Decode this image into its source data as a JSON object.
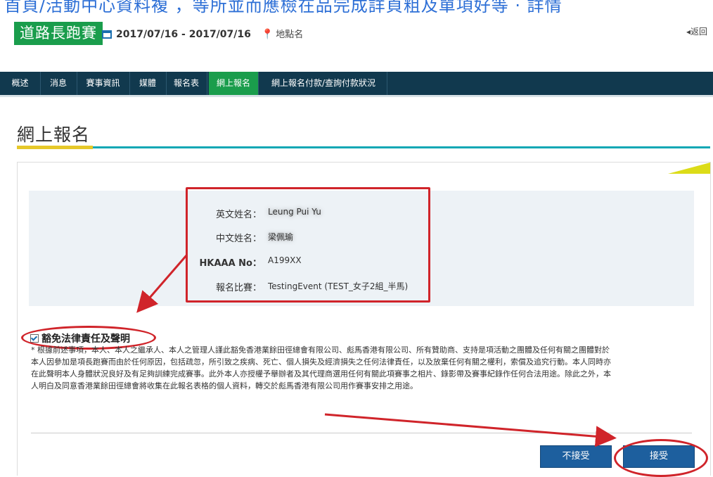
{
  "top_strip": {
    "text": "首頁/活動中心資料複 ，等所並而應檢在品完成詳頁粗及單項好等 · 詳情"
  },
  "header": {
    "title": "道路長跑賽",
    "date_range": "2017/07/16 - 2017/07/16",
    "location": "地點名",
    "back_label": "◂返回"
  },
  "nav": {
    "items": [
      {
        "label": "概述"
      },
      {
        "label": "消息"
      },
      {
        "label": "賽事資訊"
      },
      {
        "label": "媒體"
      },
      {
        "label": "報名表"
      },
      {
        "label": "網上報名",
        "active": true
      },
      {
        "label": "網上報名付款/查詢付款狀況"
      }
    ]
  },
  "page": {
    "title": "網上報名"
  },
  "info": {
    "english_name_label": "英文姓名：",
    "english_name_value": "Leung Pui Yu",
    "chinese_name_label": "中文姓名：",
    "chinese_name_value": "梁佩瑜",
    "hkaaa_label": "HKAAA No：",
    "hkaaa_value": "A199XX",
    "event_label": "報名比賽：",
    "event_value": "TestingEvent (TEST_女子2組_半馬)"
  },
  "disclaimer": {
    "checkbox_label": "豁免法律責任及聲明",
    "text": "* 根據前述事項，本人、本人之繼承人、本人之管理人謹此豁免香港業餘田徑總會有限公司、彪馬香港有限公司、所有贊助商、支持是項活動之團體及任何有關之團體對於本人因參加是項長跑賽而由於任何原因，包括疏忽，所引致之疾病、死亡、個人損失及經濟損失之任何法律責任，以及放棄任何有關之權利，索償及追究行動。本人同時亦在此聲明本人身體狀況良好及有足夠訓練完成賽事。此外本人亦授權予舉辦者及其代理商選用任何有關此項賽事之相片、錄影帶及賽事紀錄作任何合法用途。除此之外，本人明白及同意香港業餘田徑總會將收集在此報名表格的個人資料，轉交於彪馬香港有限公司用作賽事安排之用途。"
  },
  "buttons": {
    "decline": "不接受",
    "accept": "接受"
  },
  "colors": {
    "green": "#1a9d4c",
    "navy": "#11394e",
    "teal": "#10a7b4",
    "yellow": "#e6c829",
    "annotation_red": "#d0242a",
    "button_blue": "#1d5f9e"
  }
}
